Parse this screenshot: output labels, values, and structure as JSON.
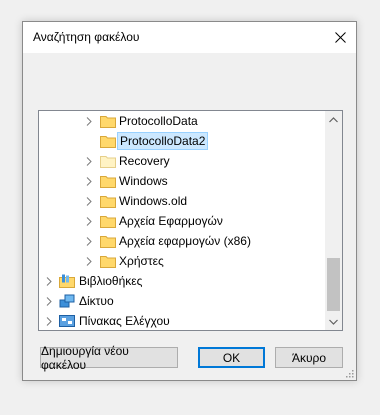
{
  "window": {
    "title": "Αναζήτηση φακέλου"
  },
  "tree": {
    "items": [
      {
        "label": "ProtocolloData",
        "icon": "folder-icon",
        "expandable": true,
        "selected": false
      },
      {
        "label": "ProtocolloData2",
        "icon": "folder-icon",
        "expandable": false,
        "selected": true
      },
      {
        "label": "Recovery",
        "icon": "folder-icon",
        "expandable": true,
        "selected": false
      },
      {
        "label": "Windows",
        "icon": "folder-icon",
        "expandable": true,
        "selected": false
      },
      {
        "label": "Windows.old",
        "icon": "folder-icon",
        "expandable": true,
        "selected": false
      },
      {
        "label": "Αρχεία Εφαρμογών",
        "icon": "folder-icon",
        "expandable": true,
        "selected": false
      },
      {
        "label": "Αρχεία εφαρμογών (x86)",
        "icon": "folder-icon",
        "expandable": true,
        "selected": false
      },
      {
        "label": "Χρήστες",
        "icon": "folder-icon",
        "expandable": true,
        "selected": false
      },
      {
        "label": "Βιβλιοθήκες",
        "icon": "libraries-icon",
        "expandable": true,
        "selected": false
      },
      {
        "label": "Δίκτυο",
        "icon": "network-icon",
        "expandable": true,
        "selected": false
      },
      {
        "label": "Πίνακας Ελέγχου",
        "icon": "control-panel-icon",
        "expandable": true,
        "selected": false
      }
    ]
  },
  "buttons": {
    "new_folder": "Δημιουργία νέου φακέλου",
    "ok": "OK",
    "cancel": "Άκυρο"
  },
  "colors": {
    "selection_bg": "#cce8ff",
    "folder": "#ffd86b",
    "default_button_border": "#0078d7"
  }
}
